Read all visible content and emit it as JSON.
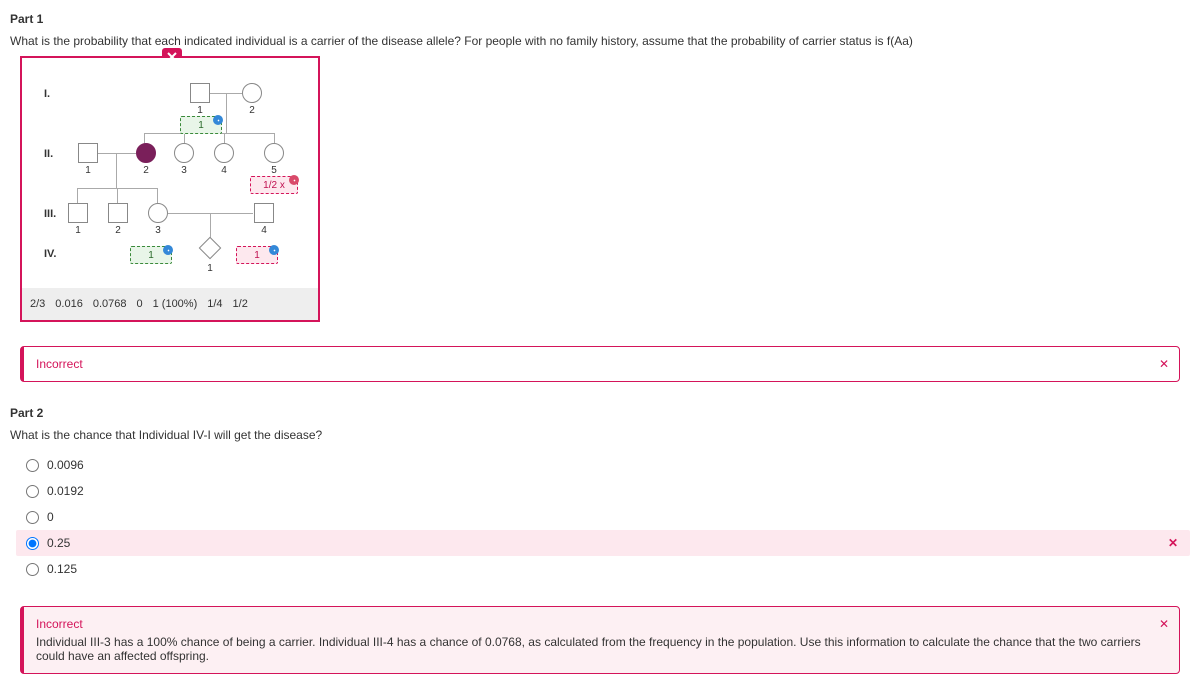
{
  "part1": {
    "title": "Part 1",
    "prompt": "What is the probability that each indicated individual is a carrier of the disease allele? For people with no family history, assume that the probability of carrier status is f(Aa)",
    "generations": {
      "g1": "I.",
      "g2": "II.",
      "g3": "III.",
      "g4": "IV."
    },
    "nums": {
      "i1": "1",
      "i2": "2",
      "ii1": "1",
      "ii2": "2",
      "ii3": "3",
      "ii4": "4",
      "ii5": "5",
      "iii1": "1",
      "iii2": "2",
      "iii3": "3",
      "iii4": "4",
      "iv1": "1"
    },
    "dz": {
      "i1": "1",
      "ii5": "1/2 x",
      "iv_left": "1",
      "iv_right": "1"
    },
    "chips": [
      "2/3",
      "0.016",
      "0.0768",
      "0",
      "1 (100%)",
      "1/4",
      "1/2"
    ],
    "feedback_label": "Incorrect"
  },
  "part2": {
    "title": "Part 2",
    "prompt": "What is the chance that Individual IV-I will get the disease?",
    "options": [
      "0.0096",
      "0.0192",
      "0",
      "0.25",
      "0.125"
    ],
    "selected_index": 3,
    "feedback_label": "Incorrect",
    "feedback_body": "Individual III-3 has a 100% chance of being a carrier. Individual III-4 has a chance of 0.0768, as calculated from the frequency in the population. Use this information to calculate the chance that the two carriers could have an affected offspring."
  }
}
